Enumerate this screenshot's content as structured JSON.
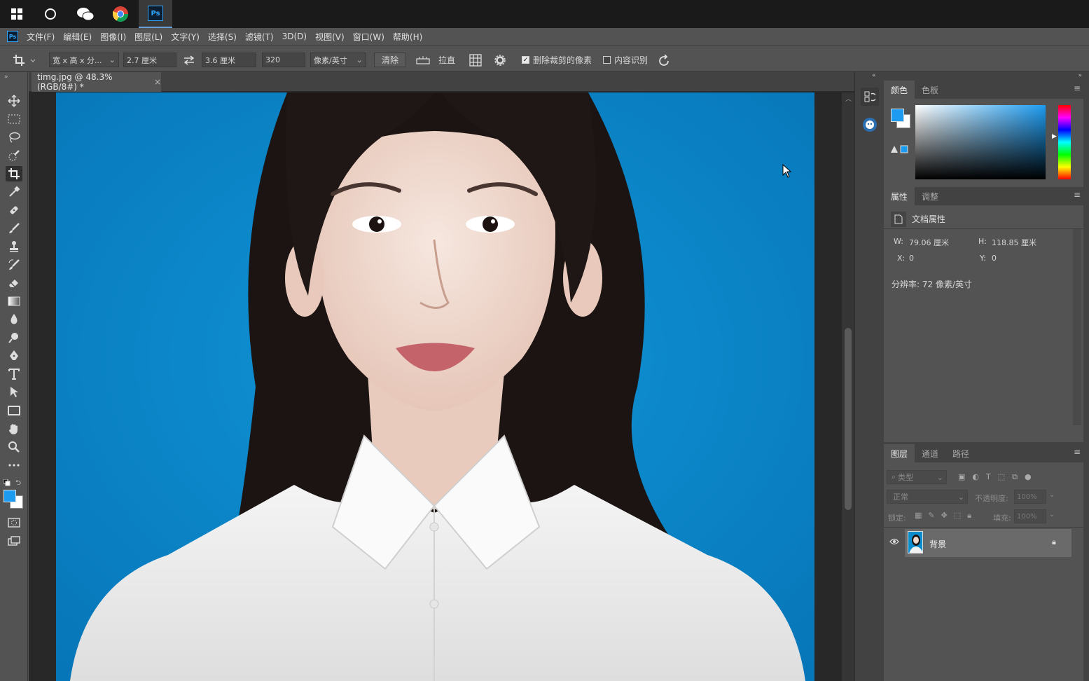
{
  "taskbar": {
    "items": [
      "windows-start",
      "cortana",
      "wechat",
      "chrome",
      "photoshop"
    ]
  },
  "menubar": {
    "items": [
      "文件(F)",
      "编辑(E)",
      "图像(I)",
      "图层(L)",
      "文字(Y)",
      "选择(S)",
      "滤镜(T)",
      "3D(D)",
      "视图(V)",
      "窗口(W)",
      "帮助(H)"
    ]
  },
  "options": {
    "preset": "宽 x 高 x 分...",
    "width": "2.7 厘米",
    "height": "3.6 厘米",
    "resolution": "320",
    "resolution_unit": "像素/英寸",
    "clear": "清除",
    "straighten": "拉直",
    "delete_cropped": "删除裁剪的像素",
    "delete_cropped_checked": true,
    "content_aware": "内容识别",
    "content_aware_checked": false
  },
  "document": {
    "tab_title": "timg.jpg @ 48.3%(RGB/8#) *",
    "close": "×"
  },
  "colors": {
    "foreground": "#1d9bf0",
    "background": "#ffffff",
    "canvas_bg": "#0b8ccd"
  },
  "color_panel": {
    "tabs": [
      "颜色",
      "色板"
    ]
  },
  "properties_panel": {
    "tabs": [
      "属性",
      "调整"
    ],
    "header": "文档属性",
    "w_label": "W:",
    "w_value": "79.06 厘米",
    "h_label": "H:",
    "h_value": "118.85 厘米",
    "x_label": "X:",
    "x_value": "0",
    "y_label": "Y:",
    "y_value": "0",
    "resolution": "分辨率: 72 像素/英寸"
  },
  "layers_panel": {
    "tabs": [
      "图层",
      "通道",
      "路径"
    ],
    "filter_placeholder": "类型",
    "blend_mode": "正常",
    "opacity_label": "不透明度:",
    "opacity_value": "100%",
    "lock_label": "锁定:",
    "fill_label": "填充:",
    "fill_value": "100%",
    "layer_name": "背景"
  }
}
